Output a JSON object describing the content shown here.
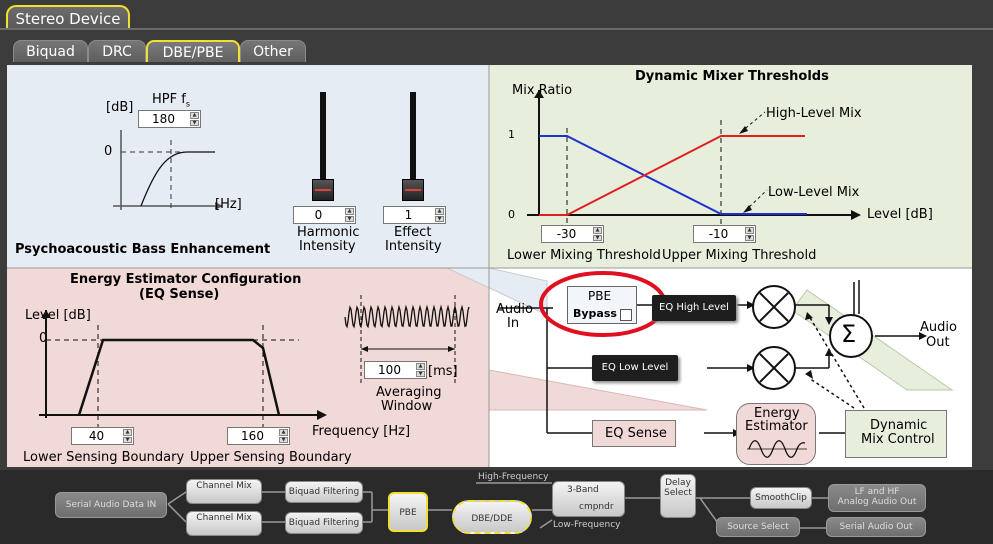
{
  "window": {
    "device_tab": "Stereo Device"
  },
  "tabs": [
    {
      "label": "Biquad"
    },
    {
      "label": "DRC"
    },
    {
      "label": "DBE/PBE",
      "active": true
    },
    {
      "label": "Other"
    }
  ],
  "pbe": {
    "title": "Psychoacoustic Bass Enhancement",
    "hpf_label": "HPF f",
    "hpf_sub": "s",
    "hpf_value": "180",
    "db_label": "[dB]",
    "zero": "0",
    "hz_label": "[Hz]",
    "harmonic": {
      "value": "0",
      "label1": "Harmonic",
      "label2": "Intensity",
      "level": 0
    },
    "effect": {
      "value": "1",
      "label1": "Effect",
      "label2": "Intensity",
      "level": 0
    }
  },
  "mixer": {
    "title": "Dynamic Mixer Thresholds",
    "y_label": "Mix Ratio",
    "y_one": "1",
    "y_zero": "0",
    "x_label": "Level [dB]",
    "high_mix": "High-Level Mix",
    "low_mix": "Low-Level Mix",
    "lower_value": "-30",
    "lower_label": "Lower Mixing Threshold",
    "upper_value": "-10",
    "upper_label": "Upper Mixing Threshold"
  },
  "energy": {
    "title1": "Energy Estimator Configuration",
    "title2": "(EQ Sense)",
    "level_label": "Level [dB]",
    "zero": "0",
    "freq_label": "Frequency [Hz]",
    "lower_value": "40",
    "lower_label": "Lower Sensing Boundary",
    "upper_value": "160",
    "upper_label": "Upper Sensing Boundary",
    "avg_value": "100",
    "avg_unit": "[ms]",
    "avg_label1": "Averaging",
    "avg_label2": "Window"
  },
  "signal": {
    "audio_in1": "Audio",
    "audio_in2": "In",
    "pbe": "PBE",
    "bypass": "Bypass",
    "eq_high": "EQ High Level",
    "eq_low": "EQ Low Level",
    "eq_sense": "EQ Sense",
    "energy1": "Energy",
    "energy2": "Estimator",
    "dyn1": "Dynamic",
    "dyn2": "Mix Control",
    "sigma": "Σ",
    "audio_out1": "Audio",
    "audio_out2": "Out",
    "colors": {
      "high": "#e02020",
      "low": "#2030d0",
      "highlight": "#e01020"
    }
  },
  "flow": {
    "serial_in": "Serial Audio Data IN",
    "ch_mix": "Channel Mix",
    "biquad": "Biquad Filtering",
    "pbe": "PBE",
    "dbe": "DBE/DDE",
    "high_freq": "High-Frequency",
    "low_freq": "Low-Frequency",
    "three_band": "3-Band",
    "cmpndr": "cmpndr",
    "delay1": "Delay",
    "delay2": "Select",
    "smooth": "SmoothClip",
    "lf_hf1": "LF and HF",
    "lf_hf2": "Analog Audio Out",
    "source": "Source Select",
    "serial_out": "Serial Audio Out"
  }
}
